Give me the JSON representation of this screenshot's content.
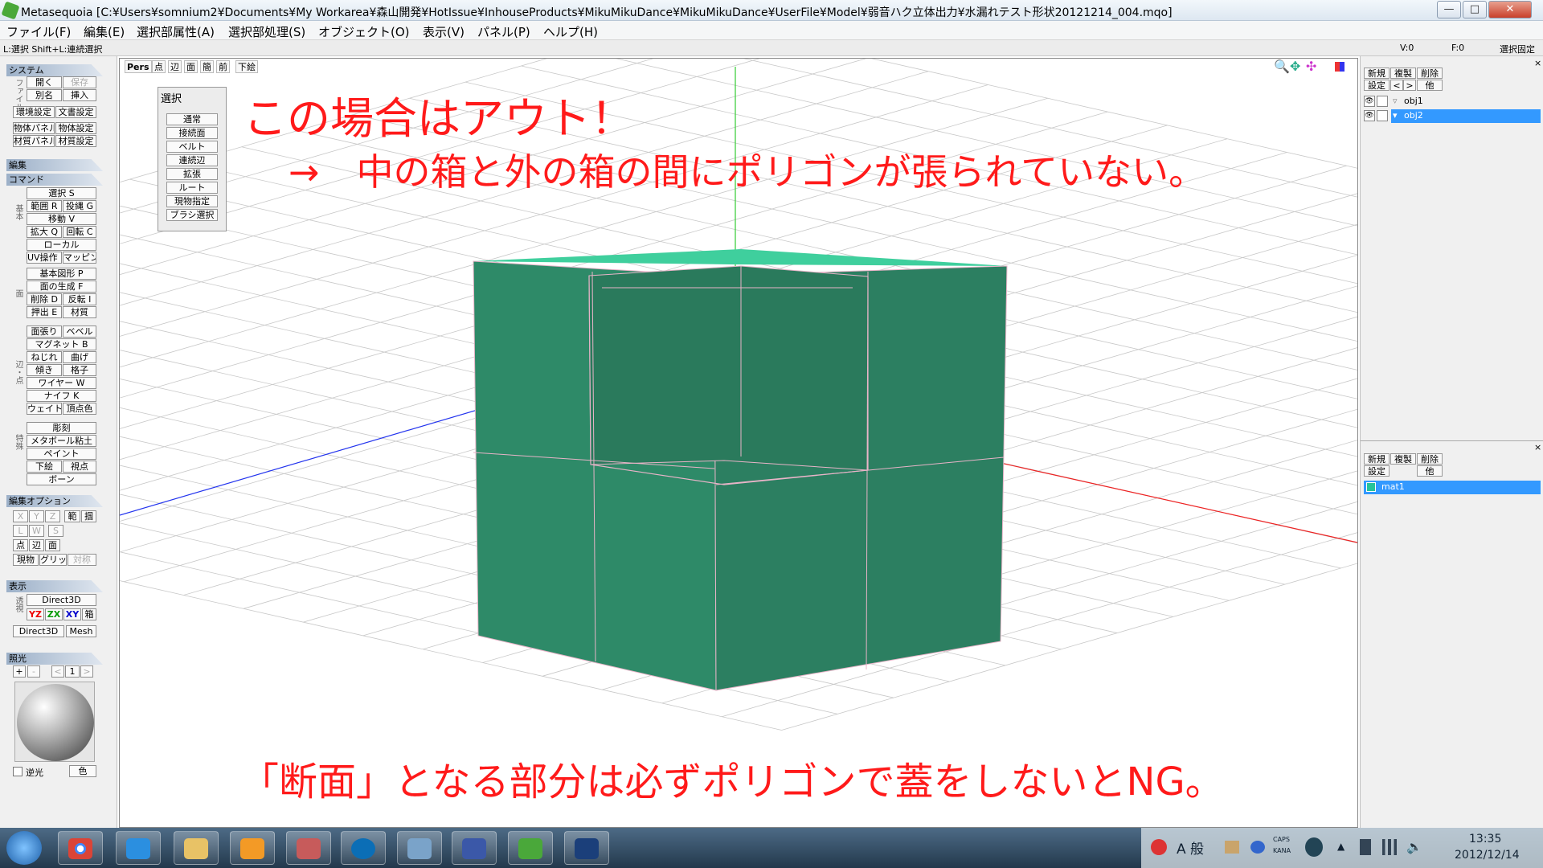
{
  "window": {
    "title": "Metasequoia [C:¥Users¥somnium2¥Documents¥My Workarea¥森山開発¥HotIssue¥InhouseProducts¥MikuMikuDance¥MikuMikuDance¥UserFile¥Model¥弱音ハク立体出力¥水漏れテスト形状20121214_004.mqo]",
    "minimize": "—",
    "maximize": "□",
    "close": "✕"
  },
  "menu": [
    "ファイル(F)",
    "編集(E)",
    "選択部属性(A)",
    "選択部処理(S)",
    "オブジェクト(O)",
    "表示(V)",
    "パネル(P)",
    "ヘルプ(H)"
  ],
  "status": {
    "hint": "L:選択  Shift+L:連続選択",
    "v": "V:0",
    "f": "F:0",
    "mode": "選択固定"
  },
  "left": {
    "system_head": "システム",
    "file_label": "ファイル",
    "open": "開く",
    "save": "保存",
    "save_as": "別名",
    "insert": "挿入",
    "env": "環境設定",
    "doc": "文書設定",
    "objpanel": "物体パネル",
    "objset": "物体設定",
    "matpanel": "材質パネル",
    "matset": "材質設定",
    "edit_head": "編集",
    "command_head": "コマンド",
    "side_basic": "基本",
    "side_face": "面",
    "side_edge": "辺・点",
    "side_special": "特殊",
    "cmds": [
      "選択 S",
      "範囲 R",
      "投縄 G",
      "移動 V",
      "拡大 Q",
      "回転 C",
      "ローカル",
      "UV操作 U",
      "マッピング",
      "基本図形 P",
      "面の生成 F",
      "削除 D",
      "反転 I",
      "押出 E",
      "材質",
      "面張り",
      "ベベル",
      "マグネット B",
      "ねじれ",
      "曲げ",
      "傾き",
      "格子",
      "ワイヤー W",
      "ナイフ K",
      "ウェイト",
      "頂点色",
      "彫刻",
      "メタボール粘土",
      "ペイント",
      "下絵",
      "視点",
      "ボーン"
    ],
    "editopt_head": "編集オプション",
    "opts": [
      "X",
      "Y",
      "Z",
      "範",
      "掴",
      "L",
      "W",
      "S",
      "点",
      "辺",
      "面",
      "現物",
      "グリッド",
      "対称"
    ],
    "display_head": "表示",
    "display_side": "透視",
    "direct3d": "Direct3D",
    "yz": "YZ",
    "zx": "ZX",
    "xy": "XY",
    "box": "箱",
    "direct3d2": "Direct3D",
    "mesh": "Mesh",
    "light_head": "照光",
    "light_plus": "+",
    "light_minus": "-",
    "light_prev": "<",
    "light_num": "1",
    "light_next": ">",
    "reverse_light": "逆光",
    "color": "色"
  },
  "viewport": {
    "toolbar": [
      "Pers",
      "点",
      "辺",
      "面",
      "簡",
      "前",
      "下絵"
    ]
  },
  "selection_panel": {
    "title": "選択",
    "items": [
      "通常",
      "接続面",
      "ベルト",
      "連続辺",
      "拡張",
      "ルート",
      "現物指定",
      "ブラシ選択"
    ]
  },
  "annotations": {
    "line1": "この場合はアウト！",
    "line2": "→　中の箱と外の箱の間にポリゴンが張られていない。",
    "line3": "「断面」となる部分は必ずポリゴンで蓋をしないとNG。"
  },
  "objects": {
    "new": "新規",
    "copy": "複製",
    "delete": "削除",
    "settings": "設定",
    "prev": "<",
    "next": ">",
    "other": "他",
    "items": [
      "obj1",
      "obj2"
    ],
    "selected": "obj2"
  },
  "materials": {
    "new": "新規",
    "copy": "複製",
    "delete": "削除",
    "settings": "設定",
    "other": "他",
    "items": [
      "mat1"
    ],
    "mat_color": "#27c49a"
  },
  "taskbar": {
    "ime": "A 般",
    "caps": "CAPS",
    "kana": "KANA",
    "time": "13:35",
    "date": "2012/12/14"
  },
  "colors": {
    "model_fill": "#2e8a68",
    "model_top": "#3fcf9d",
    "edge": "#e8b4c8",
    "axis_y": "#33cc33",
    "axis_x": "#ee2222",
    "axis_z": "#2233ee",
    "annotation": "#ff1a1a",
    "selection": "#3399ff"
  }
}
